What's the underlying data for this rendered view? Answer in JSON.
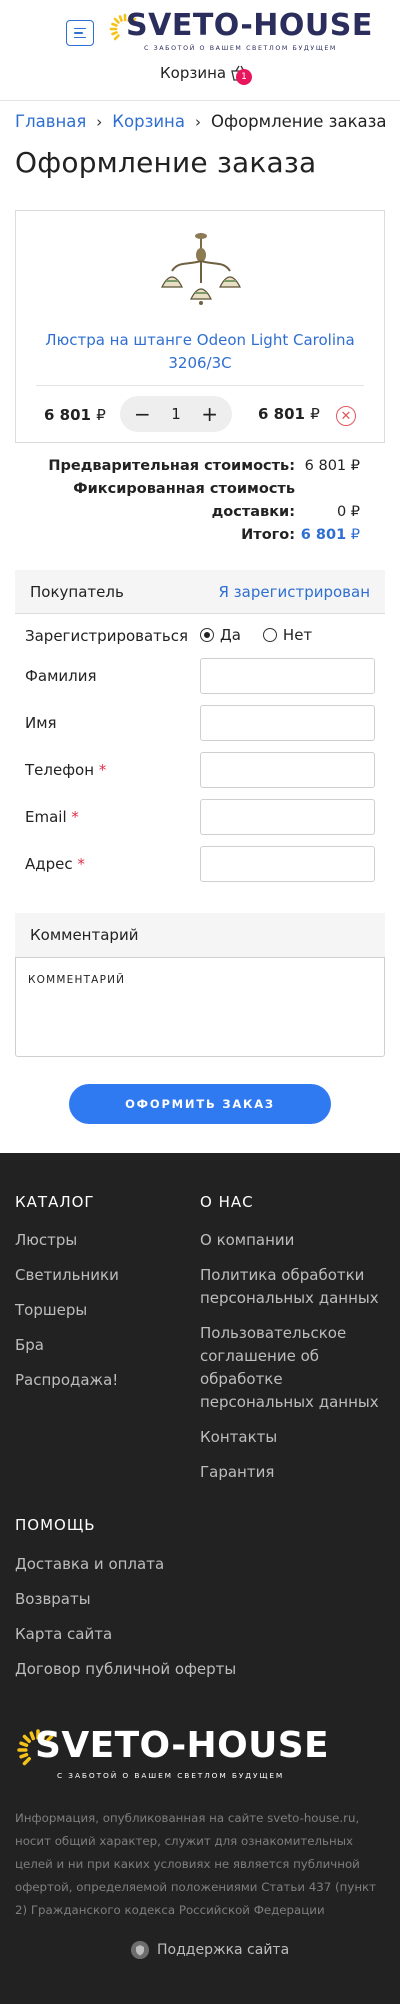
{
  "header": {
    "logo_text": "SVETO-HOUSE",
    "logo_tagline": "С ЗАБОТОЙ О ВАШЕМ СВЕТЛОМ БУДУЩЕМ",
    "cart_label": "Корзина",
    "cart_count": "1",
    "menu_icon": "hamburger-icon"
  },
  "breadcrumb": {
    "home": "Главная",
    "separator": "›",
    "cart": "Корзина",
    "current": "Оформление заказа"
  },
  "page_title": "Оформление заказа",
  "cart_item": {
    "name": "Люстра на штанге Odeon Light Carolina 3206/3C",
    "unit_price": "6 801",
    "quantity": "1",
    "total_price": "6 801",
    "currency": "₽",
    "minus": "−",
    "plus": "+",
    "remove_icon": "close-circle-icon"
  },
  "totals": {
    "subtotal_label": "Предварительная стоимость:",
    "subtotal_value": "6 801 ₽",
    "delivery_label_1": "Фиксированная стоимость",
    "delivery_label_2": "доставки:",
    "delivery_value": "0 ₽",
    "total_label": "Итого:",
    "total_value": "6 801",
    "currency": "₽"
  },
  "buyer": {
    "title": "Покупатель",
    "registered_link": "Я зарегистрирован",
    "register_label": "Зарегистрироваться",
    "yes": "Да",
    "no": "Нет",
    "register_selected": "Да",
    "fields": {
      "last_name": "Фамилия",
      "first_name": "Имя",
      "phone": "Телефон",
      "email": "Email",
      "address": "Адрес"
    },
    "required_mark": "*"
  },
  "comment": {
    "title": "Комментарий",
    "placeholder": "КОММЕНТАРИЙ"
  },
  "submit_label": "ОФОРМИТЬ ЗАКАЗ",
  "footer": {
    "catalog_title": "КАТАЛОГ",
    "catalog_links": [
      "Люстры",
      "Светильники",
      "Торшеры",
      "Бра",
      "Распродажа!"
    ],
    "about_title": "О НАС",
    "about_links": [
      "О компании",
      "Политика обработки персональных данных",
      "Пользовательское соглашение об обработке персональных данных",
      "Контакты",
      "Гарантия"
    ],
    "help_title": "ПОМОЩЬ",
    "help_links": [
      "Доставка и оплата",
      "Возвраты",
      "Карта сайта",
      "Договор публичной оферты"
    ],
    "logo_text": "SVETO-HOUSE",
    "logo_tagline": "С ЗАБОТОЙ О ВАШЕМ СВЕТЛОМ БУДУЩЕМ",
    "info": "Информация, опубликованная на сайте sveto-house.ru, носит общий характер, служит для ознакомительных целей и ни при каких условиях не является публичной офертой, определяемой положениями Статьи 437 (пункт 2) Гражданского кодекса Российской Федерации",
    "support_label": "Поддержка сайта"
  },
  "colors": {
    "accent": "#2f6fd1",
    "button": "#2f7af0",
    "badge": "#e8175d",
    "footer_bg": "#222222",
    "logo_dark": "#2b2d5c",
    "sun": "#f5c21a"
  }
}
